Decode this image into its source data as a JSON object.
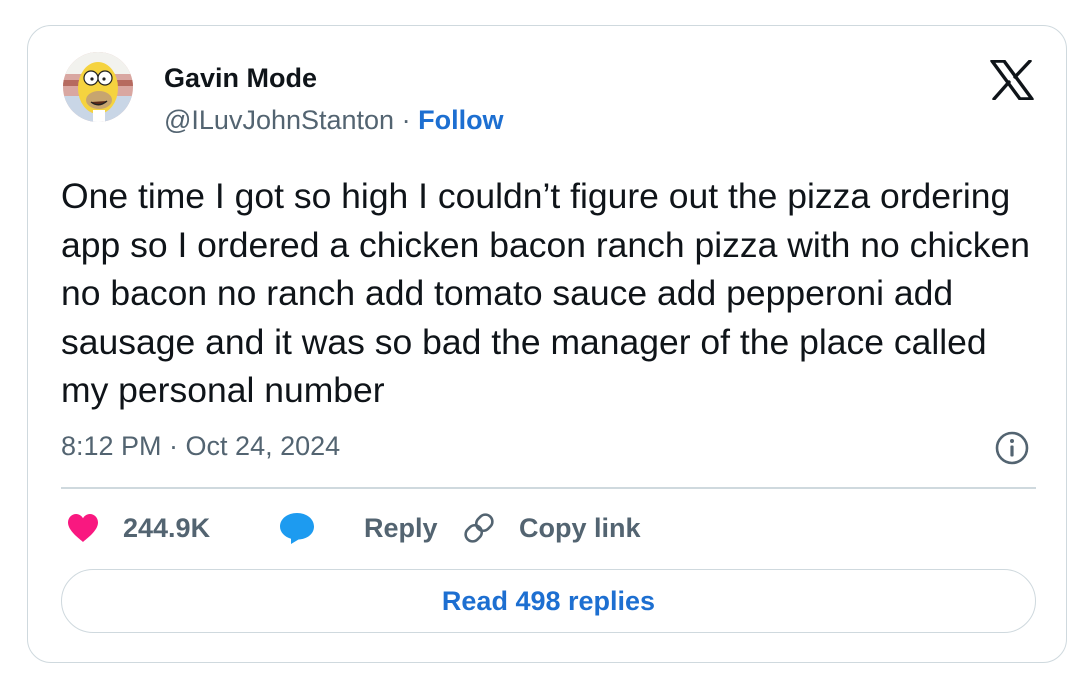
{
  "author": {
    "name": "Gavin Mode",
    "handle": "@ILuvJohnStanton",
    "separator": " · ",
    "follow_label": "Follow"
  },
  "tweet": {
    "text": "One time I got so high I couldn’t figure out the pizza ordering app so I ordered a chicken bacon ranch pizza with no chicken no bacon no ranch add tomato sauce add pepperoni add sausage and it was so bad the manager of the place called my personal number",
    "timestamp": "8:12 PM · Oct 24, 2024"
  },
  "actions": {
    "like_count": "244.9K",
    "reply_label": "Reply",
    "copy_link_label": "Copy link"
  },
  "read_replies_label": "Read 498 replies",
  "colors": {
    "like": "#f91880",
    "reply": "#1d9bf0",
    "link": "#1d6fd1",
    "secondary_text": "#536471",
    "border": "#cfd9de"
  },
  "icons": [
    "avatar",
    "x-logo-icon",
    "info-icon",
    "heart-icon",
    "reply-bubble-icon",
    "link-icon"
  ]
}
